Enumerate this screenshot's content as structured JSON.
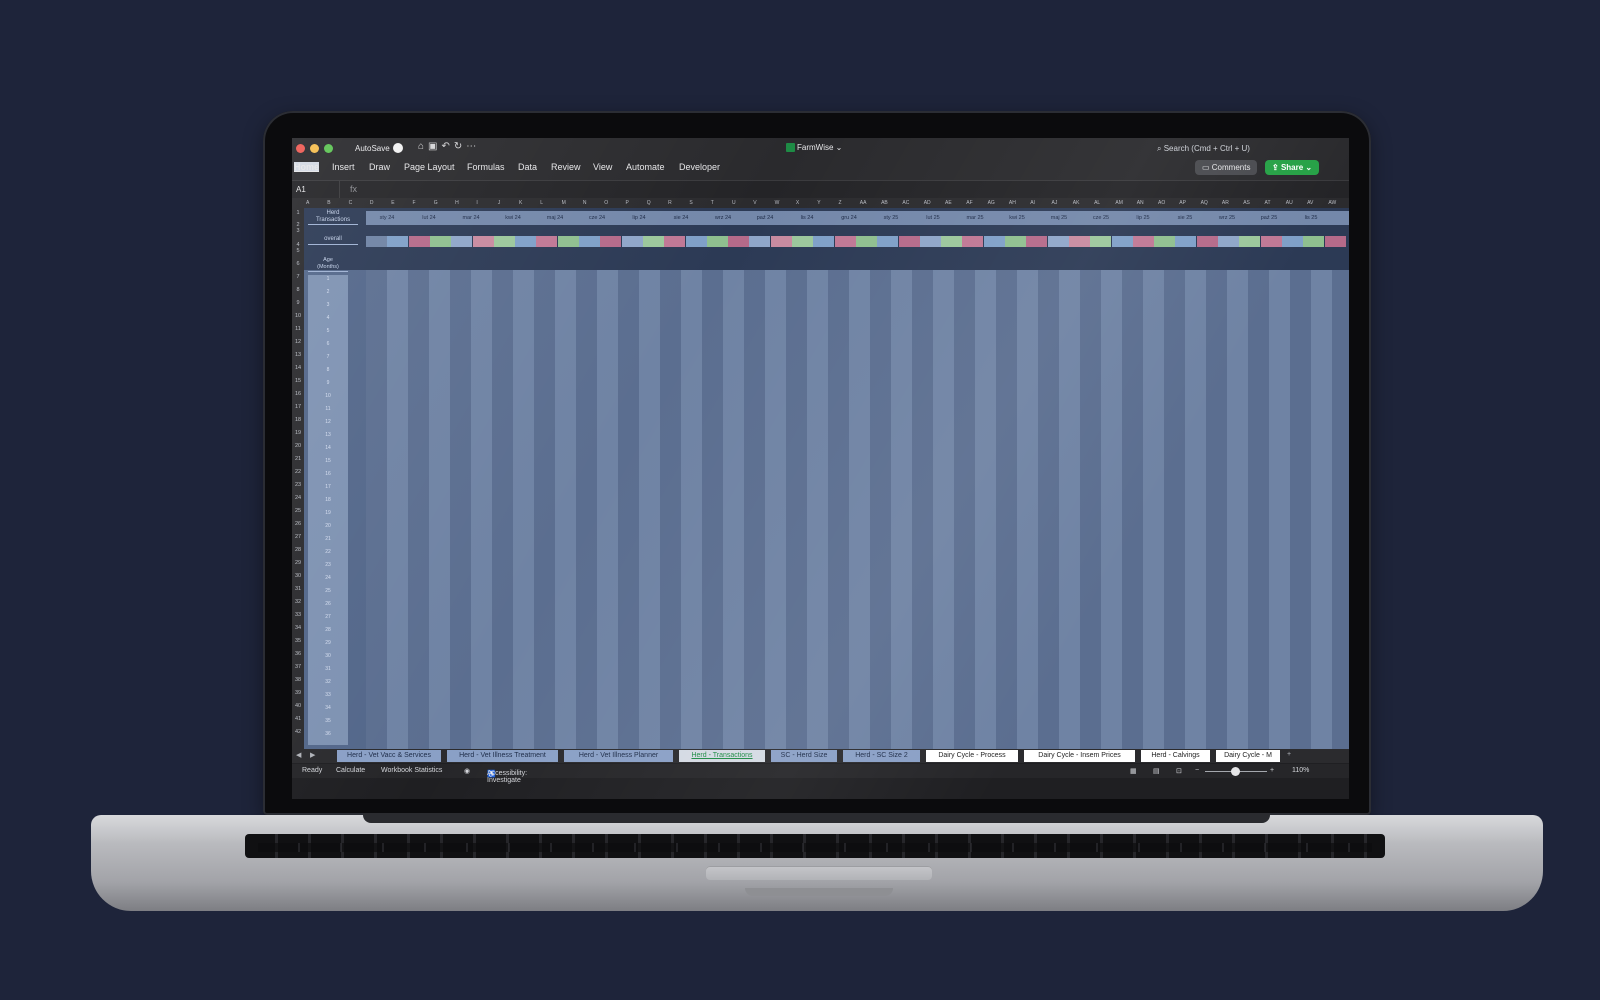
{
  "window": {
    "autosave_label": "AutoSave",
    "doc_title": "FarmWise ⌄",
    "search_placeholder": "Search (Cmd + Ctrl + U)"
  },
  "ribbon": {
    "tabs": [
      "Home",
      "Insert",
      "Draw",
      "Page Layout",
      "Formulas",
      "Data",
      "Review",
      "View",
      "Automate",
      "Developer"
    ],
    "comments_label": "Comments",
    "share_label": "Share"
  },
  "formula_bar": {
    "name_box": "A1",
    "fx": "fx"
  },
  "sheet": {
    "title_line1": "Herd",
    "title_line2": "Transactions",
    "overall_label": "overall",
    "age_label_line1": "Age",
    "age_label_line2": "(Months)",
    "columns": [
      "A",
      "B",
      "C",
      "D",
      "E",
      "F",
      "G",
      "H",
      "I",
      "J",
      "K",
      "L",
      "M",
      "N",
      "O",
      "P",
      "Q",
      "R",
      "S",
      "T",
      "U",
      "V",
      "W",
      "X",
      "Y",
      "Z",
      "AA",
      "AB",
      "AC",
      "AD",
      "AE",
      "AF",
      "AG",
      "AH",
      "AI",
      "AJ",
      "AK",
      "AL",
      "AM",
      "AN",
      "AO",
      "AP",
      "AQ",
      "AR",
      "AS",
      "AT",
      "AU",
      "AV",
      "AW"
    ],
    "rows": [
      "1",
      "2",
      "3",
      "4",
      "5",
      "6",
      "7",
      "8",
      "9",
      "10",
      "11",
      "12",
      "13",
      "14",
      "15",
      "16",
      "17",
      "18",
      "19",
      "20",
      "21",
      "22",
      "23",
      "24",
      "25",
      "26",
      "27",
      "28",
      "29",
      "30",
      "31",
      "32",
      "33",
      "34",
      "35",
      "36",
      "37",
      "38",
      "39",
      "40",
      "41",
      "42"
    ],
    "months": [
      "sty 24",
      "lut 24",
      "mar 24",
      "kwi 24",
      "maj 24",
      "cze 24",
      "lip 24",
      "sie 24",
      "wrz 24",
      "paź 24",
      "lis 24",
      "gru 24",
      "sty 25",
      "lut 25",
      "mar 25",
      "kwi 25",
      "maj 25",
      "cze 25",
      "lip 25",
      "sie 25",
      "wrz 25",
      "paź 25",
      "lis 25"
    ],
    "ages": [
      "1",
      "2",
      "3",
      "4",
      "5",
      "6",
      "7",
      "8",
      "9",
      "10",
      "11",
      "12",
      "13",
      "14",
      "15",
      "16",
      "17",
      "18",
      "19",
      "20",
      "21",
      "22",
      "23",
      "24",
      "25",
      "26",
      "27",
      "28",
      "29",
      "30",
      "31",
      "32",
      "33",
      "34",
      "35",
      "36"
    ],
    "status_colors": [
      "#6f83a4",
      "#7fa0c8",
      "#b56a8a",
      "#8fbf8f",
      "#8fa6c9",
      "#c88aa0",
      "#9cc79c",
      "#7fa0c8",
      "#c07895",
      "#8fbf8f",
      "#7fa0c8",
      "#b56a8a",
      "#8fa6c9",
      "#9cc79c",
      "#c07895",
      "#7fa0c8",
      "#8fbf8f",
      "#b56a8a",
      "#8fa6c9",
      "#c88aa0",
      "#9cc79c",
      "#7fa0c8",
      "#c07895",
      "#8fbf8f",
      "#7fa0c8",
      "#b56a8a",
      "#8fa6c9",
      "#9cc79c",
      "#c07895",
      "#7fa0c8",
      "#8fbf8f",
      "#b56a8a",
      "#8fa6c9",
      "#c88aa0",
      "#9cc79c",
      "#7fa0c8",
      "#c07895",
      "#8fbf8f",
      "#7fa0c8",
      "#b56a8a",
      "#8fa6c9",
      "#9cc79c",
      "#c07895",
      "#7fa0c8",
      "#8fbf8f",
      "#b56a8a"
    ]
  },
  "sheet_tabs": [
    {
      "label": "Herd - Vet Vacc & Services",
      "style": "blue"
    },
    {
      "label": "Herd - Vet Illness Treatment",
      "style": "blue"
    },
    {
      "label": "Herd - Vet Illness Planner",
      "style": "blue"
    },
    {
      "label": "Herd - Transactions",
      "style": "active"
    },
    {
      "label": "SC - Herd Size",
      "style": "blue"
    },
    {
      "label": "Herd - SC  Size 2",
      "style": "blue"
    },
    {
      "label": "Dairy Cycle - Process",
      "style": "white"
    },
    {
      "label": "Dairy Cycle - Insem Prices",
      "style": "white"
    },
    {
      "label": "Herd - Calvings",
      "style": "white"
    },
    {
      "label": "Dairy Cycle - M",
      "style": "white"
    }
  ],
  "status_bar": {
    "ready": "Ready",
    "calculate": "Calculate",
    "workbook_statistics": "Workbook Statistics",
    "accessibility": "Accessibility: Investigate",
    "zoom": "110%"
  },
  "colors": {
    "accent_green": "#26a146",
    "sheet_blue": "#53678a"
  }
}
